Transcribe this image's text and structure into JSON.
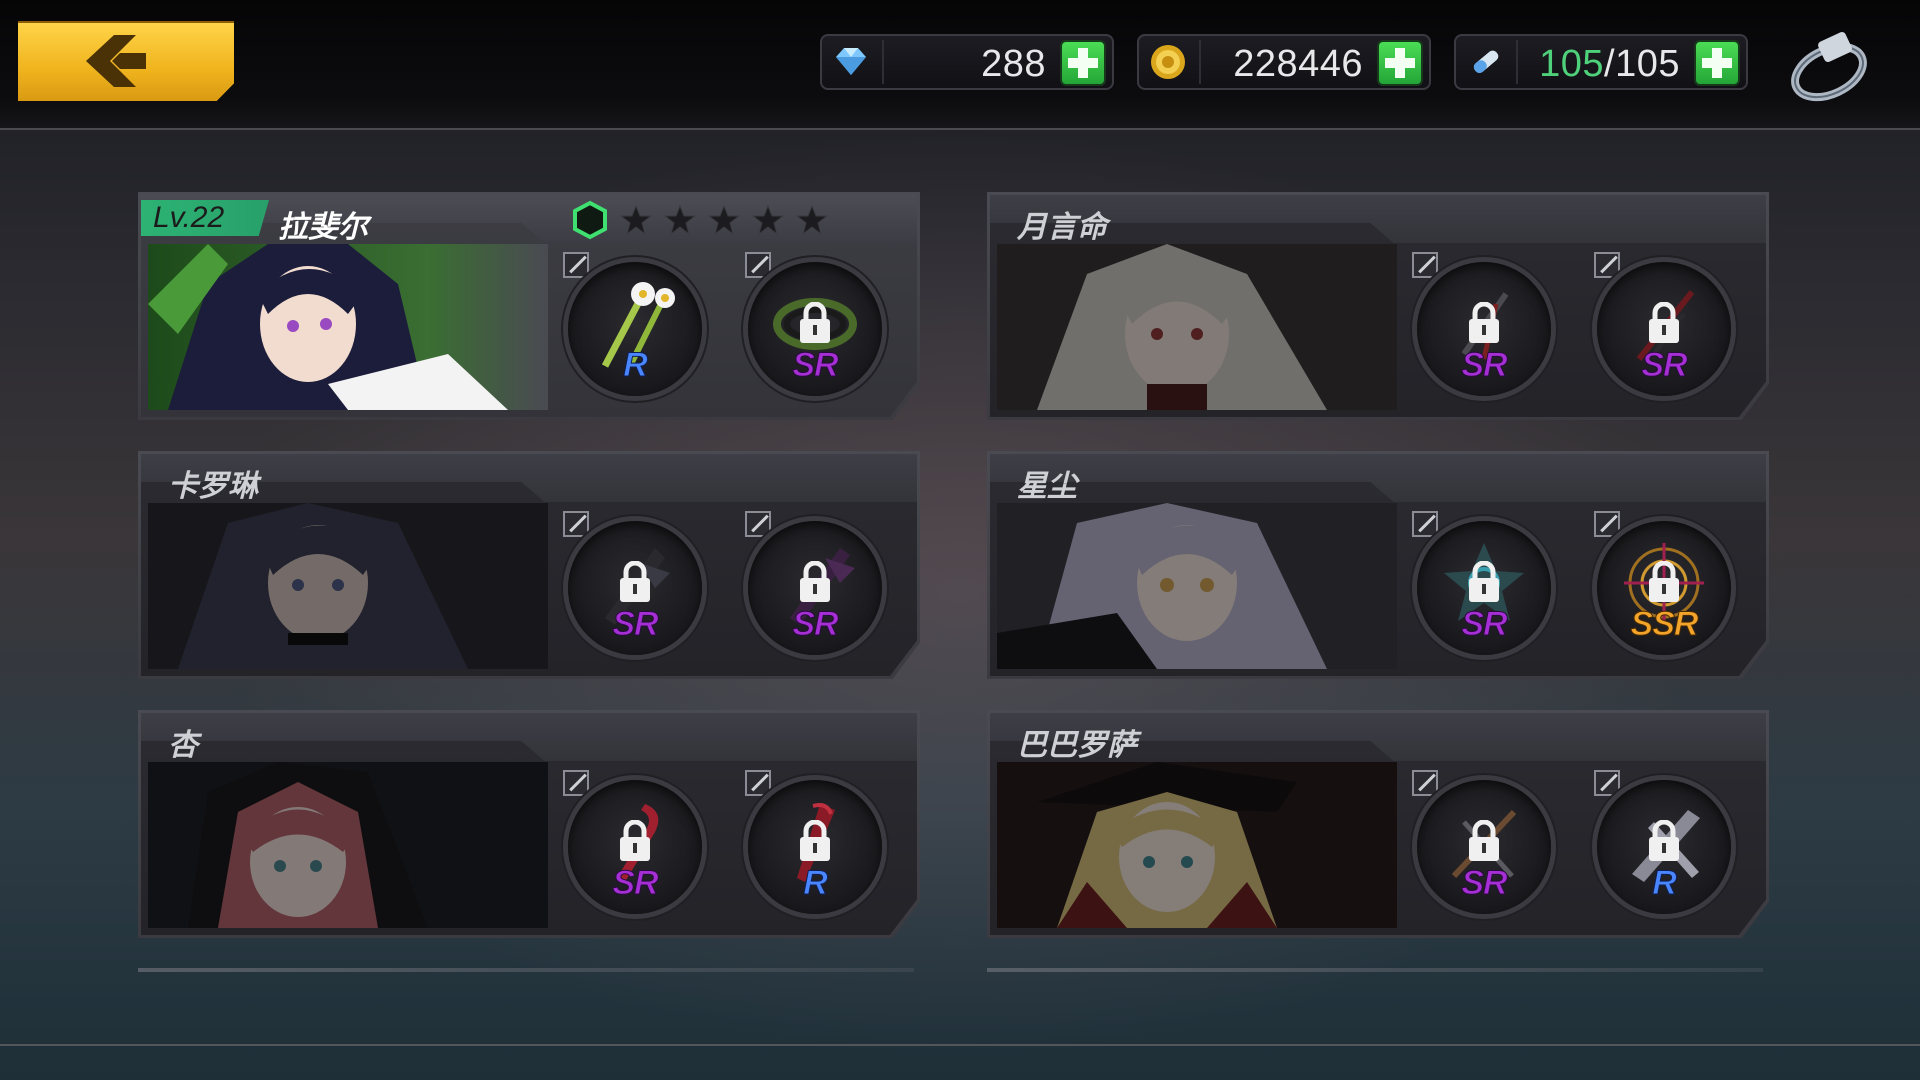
{
  "topbar": {
    "diamonds": "288",
    "coins": "228446",
    "stamina_current": "105",
    "stamina_sep": "/",
    "stamina_max": "105"
  },
  "characters": [
    {
      "name": "拉斐尔",
      "level": "Lv.22",
      "active": true,
      "stars_filled": 0,
      "stars_total": 5,
      "slots": [
        {
          "rarity": "R",
          "locked": false
        },
        {
          "rarity": "SR",
          "locked": true
        }
      ]
    },
    {
      "name": "月言命",
      "active": false,
      "slots": [
        {
          "rarity": "SR",
          "locked": true
        },
        {
          "rarity": "SR",
          "locked": true
        }
      ]
    },
    {
      "name": "卡罗琳",
      "active": false,
      "slots": [
        {
          "rarity": "SR",
          "locked": true
        },
        {
          "rarity": "SR",
          "locked": true
        }
      ]
    },
    {
      "name": "星尘",
      "active": false,
      "slots": [
        {
          "rarity": "SR",
          "locked": true
        },
        {
          "rarity": "SSR",
          "locked": true
        }
      ]
    },
    {
      "name": "杏",
      "active": false,
      "slots": [
        {
          "rarity": "SR",
          "locked": true
        },
        {
          "rarity": "R",
          "locked": true
        }
      ]
    },
    {
      "name": "巴巴罗萨",
      "active": false,
      "slots": [
        {
          "rarity": "SR",
          "locked": true
        },
        {
          "rarity": "R",
          "locked": true
        }
      ]
    }
  ],
  "colors": {
    "accent_yellow": "#f0b41e",
    "plus_green": "#2fbf45",
    "level_green": "#2db374",
    "rarity_r": "#4a86ff",
    "rarity_sr": "#a52fd4",
    "rarity_ssr": "#f3a42a"
  },
  "icons": [
    "back-arrow-icon",
    "diamond-icon",
    "coin-icon",
    "stamina-icon",
    "ring-icon",
    "plus-icon",
    "lock-icon",
    "edit-icon",
    "star-icon",
    "hexagon-icon"
  ]
}
